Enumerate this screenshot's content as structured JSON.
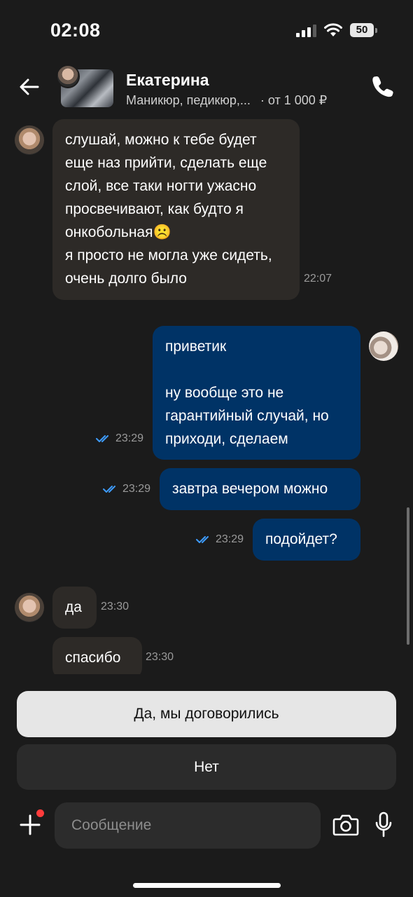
{
  "status_bar": {
    "time": "02:08",
    "battery": "50"
  },
  "header": {
    "name": "Екатерина",
    "subtitle": "Маникюр, педикюр,...",
    "price": "· от 1 000 ₽",
    "icons": [
      "back-arrow-icon",
      "phone-icon"
    ]
  },
  "messages": [
    {
      "from": "them",
      "text": "слушай, можно к тебе будет еще наз прийти, сделать еще слой, все таки ногти ужасно просвечивают, как будто я онкобольная",
      "emoji": "☹️",
      "text2": "я просто не могла уже сидеть, очень долго было",
      "time": "22:07"
    },
    {
      "from": "me",
      "text": "приветик",
      "text2": "ну вообще это не гарантийный случай, но приходи, сделаем",
      "time": "23:29"
    },
    {
      "from": "me",
      "text": "завтра вечером можно",
      "time": "23:29"
    },
    {
      "from": "me",
      "text": "подойдет?",
      "time": "23:29"
    },
    {
      "from": "them",
      "text": "да",
      "time": "23:30"
    },
    {
      "from": "them",
      "text": "спасибо",
      "time": "23:30"
    }
  ],
  "quick_replies": {
    "yes": "Да, мы договорились",
    "no": "Нет"
  },
  "composer": {
    "placeholder": "Сообщение"
  },
  "colors": {
    "background": "#1b1b1b",
    "incoming": "#2d2a27",
    "outgoing": "#003366",
    "read_ticks": "#3d9bff"
  }
}
